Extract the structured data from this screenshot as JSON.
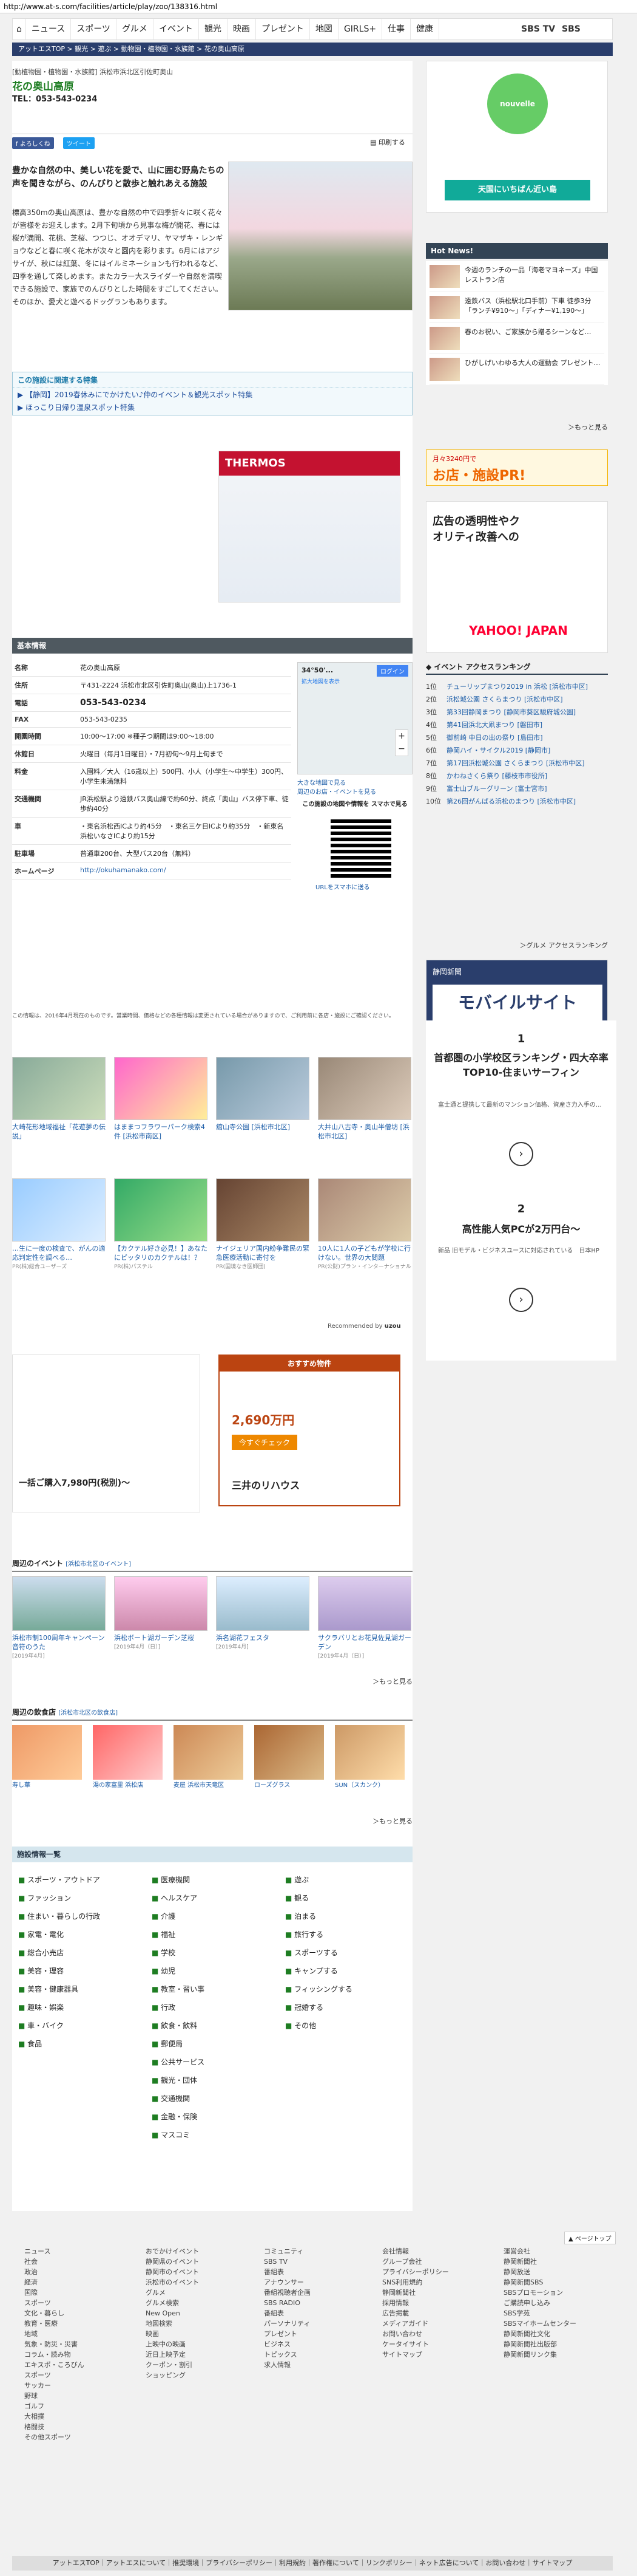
{
  "url": "http://www.at-s.com/facilities/article/play/zoo/138316.html",
  "nav": {
    "items": [
      "ニュース",
      "スポーツ",
      "グルメ",
      "イベント",
      "観光",
      "映画",
      "プレゼント",
      "地図",
      "GIRLS+",
      "仕事",
      "健康"
    ],
    "sbs_tv": "SBS TV",
    "sbs_radio": "SBS RADIO"
  },
  "breadcrumb": "アットエスTOP > 観光 > 遊ぶ > 動物園・植物園・水族館 > 花の奥山高原",
  "article": {
    "category": "[動植物園・植物園・水族館] 浜松市浜北区引佐町奥山",
    "name": "花の奥山高原",
    "tel": "TEL：053-543-0234",
    "share_fb": "f よろしくね",
    "share_tw": "ツイート",
    "print": "印刷する",
    "lead": "豊かな自然の中、美しい花を愛で、山に囲む野鳥たちの声を聞きながら、のんびりと散歩と触れあえる施設",
    "body": "標高350mの奥山高原は、豊かな自然の中で四季折々に咲く花々が皆様をお迎えします。2月下旬頃から見事な梅が開花、春には桜が満開、花桃、芝桜、つつじ、オオデマリ、ヤマザキ・レンギョウなどと春に咲く花木が次々と園内を彩ります。6月にはアジサイが、秋には紅葉、冬にはイルミネーションも行われるなど、四季を通して楽しめます。またカラー大スライダーや自然を満喫できる施設で、家族でのんびりとした時間をすごしてください。そのほか、愛犬と遊べるドッグランもあります。"
  },
  "feature": {
    "heading": "この施設に関連する特集",
    "items": [
      "【静岡】2019春休みにでかけたい♪仲のイベント＆観光スポット特集",
      "ほっこり日帰り温泉スポット特集"
    ]
  },
  "basic": {
    "heading": "基本情報",
    "rows": [
      {
        "k": "名称",
        "v": "花の奥山高原"
      },
      {
        "k": "住所",
        "v": "〒431-2224 浜松市北区引佐町奥山(奥山)上1736-1"
      },
      {
        "k": "電話",
        "v": "053-543-0234"
      },
      {
        "k": "FAX",
        "v": "053-543-0235"
      },
      {
        "k": "開園時間",
        "v": "10:00〜17:00 ※種子つ期間は9:00〜18:00"
      },
      {
        "k": "休館日",
        "v": "火曜日（毎月1日曜日）・7月初旬〜9月上旬まで"
      },
      {
        "k": "料金",
        "v": "入園料／大人（16歳以上）500円、小人（小学生〜中学生）300円、小学生未満無料"
      },
      {
        "k": "交通機関",
        "v": "JR浜松駅より遠鉄バス奥山線で約60分、終点「奥山」バス停下車、徒歩約40分"
      },
      {
        "k": "車",
        "v": "・東名浜松西ICより約45分　・東名三ケ日ICより約35分　・新東名浜松いなさICより約15分"
      },
      {
        "k": "駐車場",
        "v": "普通車200台、大型バス20台（無料）"
      },
      {
        "k": "ホームページ",
        "v": "http://okuhamanako.com/"
      }
    ],
    "map_label": "34°50'...",
    "map_login": "ログイン",
    "map_link": "拡大地図を表示",
    "map_note1": "大きな地図で見る",
    "map_note2": "周辺のお店・イベントを見る",
    "qr_title": "この施設の地図や情報を スマホで見る",
    "qr_link": "URLをスマホに送る",
    "disclaimer": "この情報は、2016年4月現在のものです。営業時間、価格などの各種情報は変更されている場合がありますので、ご利用前に各店・施設にご確認ください。"
  },
  "related": [
    {
      "cap": "大崎花形地域福祉「花遊夢の伝説」",
      "src": "PR"
    },
    {
      "cap": "はままつフラワーパーク検索4件 [浜松市南区]",
      "src": ""
    },
    {
      "cap": "舘山寺公園 [浜松市北区]",
      "src": ""
    },
    {
      "cap": "大井山八古寺・奥山半僧坊 [浜松市北区]",
      "src": ""
    },
    {
      "cap": "…生に一度の検査で、がんの適応判定性を調べる…",
      "src": "PR(株)総合ユーザーズ"
    },
    {
      "cap": "【カクテル好き必見！】あなたにピッタリのカクテルは！？",
      "src": "PR(株)パステル"
    },
    {
      "cap": "ナイジェリア国内紛争難民の緊急医療活動に寄付を",
      "src": "PR(国境なき医師団)"
    },
    {
      "cap": "10人に1人の子どもが学校に行けない。世界の大問題",
      "src": "PR(公財)プラン・インターナショナル"
    }
  ],
  "recommended": "Recommended by",
  "ad_price": "一括ご購入7,980円(税別)〜",
  "ad_house": {
    "head": "おすすめ物件",
    "price": "2,690万円",
    "btn": "今すぐチェック",
    "brand": "三井のリハウス"
  },
  "events": {
    "heading": "周辺のイベント",
    "sub": "[浜松市北区のイベント]",
    "items": [
      {
        "cap": "浜松市制100周年キャンペーン 音符のうた",
        "date": "[2019年4月]"
      },
      {
        "cap": "浜松ボート湖ガーデン芝桜",
        "date": "[2019年4月（日）]"
      },
      {
        "cap": "浜名湖花フェスタ",
        "date": "[2019年4月]"
      },
      {
        "cap": "サクラバリとお花見佐見湖ガーデン",
        "date": "[2019年4月（日）]"
      }
    ],
    "more": "＞もっと見る"
  },
  "gourmet": {
    "heading": "周辺の飲食店",
    "sub": "[浜松市北区の飲食店]",
    "items": [
      "寿し華",
      "湯の家富里 浜松店",
      "麦屋 浜松市天竜区",
      "ローズグラス",
      "SUN（スカンク）"
    ],
    "more": "＞もっと見る"
  },
  "facets": {
    "heading": "施設情報一覧",
    "col1": [
      "スポーツ・アウトドア",
      "ファッション",
      "住まい・暮らしの行政",
      "家電・電化",
      "総合小売店",
      "美容・理容",
      "美容・健康器具",
      "趣味・娯楽",
      "車・バイク",
      "食品"
    ],
    "col2": [
      "医療機関",
      "ヘルスケア",
      "介護",
      "福祉",
      "学校",
      "幼児",
      "教室・習い事",
      "行政",
      "飲食・飲料",
      "郵便局",
      "公共サービス",
      "観光・団体",
      "交通機関",
      "金融・保険",
      "マスコミ"
    ],
    "col3": [
      "遊ぶ",
      "観る",
      "泊まる",
      "旅行する",
      "スポーツする",
      "キャンプする",
      "フィッシングする",
      "冠婚する",
      "その他"
    ]
  },
  "side": {
    "ad1_text": "天国にいちばん近い島",
    "hot_heading": "Hot News!",
    "hot": [
      {
        "t": "今週のランチの一品「海老マヨネーズ」中国レストラン店"
      },
      {
        "t": "遠鉄バス（浜松駅北口手前）下車 徒歩3分「ランチ¥910〜」「ディナー¥1,190〜」"
      },
      {
        "t": "春のお祝い、ご家族から贈るシーンなど…"
      },
      {
        "t": "ひがしげいわゆる大人の運動会 プレゼント…"
      }
    ],
    "hot_more": "＞もっと見る",
    "promo1_small": "月々3240円で",
    "promo1_big": "お店・施設PR!",
    "ad_glass": "広告の透明性やクオリティ改善への",
    "yahoo": "YAHOO! JAPAN",
    "rank_heading": "イベント アクセスランキング",
    "rank": [
      {
        "n": "1位",
        "t": "チューリップまつり2019 in 浜松 [浜松市中区]"
      },
      {
        "n": "2位",
        "t": "浜松城公園 さくらまつり [浜松市中区]"
      },
      {
        "n": "3位",
        "t": "第33回静岡まつり [静岡市葵区駿府城公園]"
      },
      {
        "n": "4位",
        "t": "第41回浜北大凧まつり [磐田市]"
      },
      {
        "n": "5位",
        "t": "御前崎 中日の出の祭り [島田市]"
      },
      {
        "n": "6位",
        "t": "静岡ハイ・サイクル2019 [静岡市]"
      },
      {
        "n": "7位",
        "t": "第17回浜松城公園 さくらまつり [浜松市中区]"
      },
      {
        "n": "8位",
        "t": "かわねさくら祭り [藤枝市市役所]"
      },
      {
        "n": "9位",
        "t": "富士山ブルーグリーン [富士宮市]"
      },
      {
        "n": "10位",
        "t": "第26回がんばる浜松のまつり [浜松市中区]"
      }
    ],
    "rank_more": "＞グルメ アクセスランキング",
    "mobile_head": "静岡新聞",
    "mobile_big": "モバイルサイト",
    "pr1_num": "1",
    "pr1_title": "首都圏の小学校区ランキング・四大卒率TOP10-住まいサーフィン",
    "pr1_sub": "富士通と提携して最新のマンション価格、資産さ力入手の…",
    "pr2_num": "2",
    "pr2_title": "高性能人気PCが2万円台〜",
    "pr2_sub": "新品 旧モデル・ビジネスユースに対応されている　日本HP"
  },
  "footer": {
    "pagetop": "▲ ページトップ",
    "cols": [
      [
        "ニュース",
        "社会",
        "政治",
        "経済",
        "国際",
        "スポーツ",
        "文化・暮らし",
        "教育・医療",
        "地域",
        "気象・防災・災害",
        "コラム・読み物",
        "エキスポ・ころびん",
        "スポーツ",
        "サッカー",
        "野球",
        "ゴルフ",
        "大相撲",
        "格闘技",
        "その他スポーツ"
      ],
      [
        "おでかけイベント",
        "静岡県のイベント",
        "静岡市のイベント",
        "浜松市のイベント",
        "グルメ",
        "グルメ検索",
        "New Open",
        "地図検索",
        "映画",
        "上映中の映画",
        "近日上映予定",
        "クーポン・割引",
        "ショッピング"
      ],
      [
        "コミュニティ",
        "SBS TV",
        "番組表",
        "アナウンサー",
        "番組視聴者企画",
        "SBS RADIO",
        "番組表",
        "パーソナリティ",
        "プレゼント",
        "ビジネス",
        "トピックス",
        "求人情報"
      ],
      [
        "会社情報",
        "グループ会社",
        "プライバシーポリシー",
        "SNS利用規約",
        "静岡新聞社",
        "採用情報",
        "広告掲載",
        "メディアガイド",
        "お問い合わせ",
        "ケータイサイト",
        "サイトマップ"
      ],
      [
        "運営会社",
        "静岡新聞社",
        "静岡放送",
        "静岡新聞SBS",
        "SBSプロモーション",
        "ご購読申し込み",
        "SBS学苑",
        "SBSマイホームセンター",
        "静岡新聞社文化",
        "静岡新聞社出版部",
        "静岡新聞リンク集"
      ]
    ],
    "bottom": "アットエスTOP｜アットエスについて｜推奨環境｜プライバシーポリシー｜利用規約｜著作権について｜リンクポリシー｜ネット広告について｜お問い合わせ｜サイトマップ"
  },
  "colors": {
    "brand_nav": "#2a3e6c",
    "title_green": "#1e7d22",
    "link_blue": "#1e5ea8"
  }
}
